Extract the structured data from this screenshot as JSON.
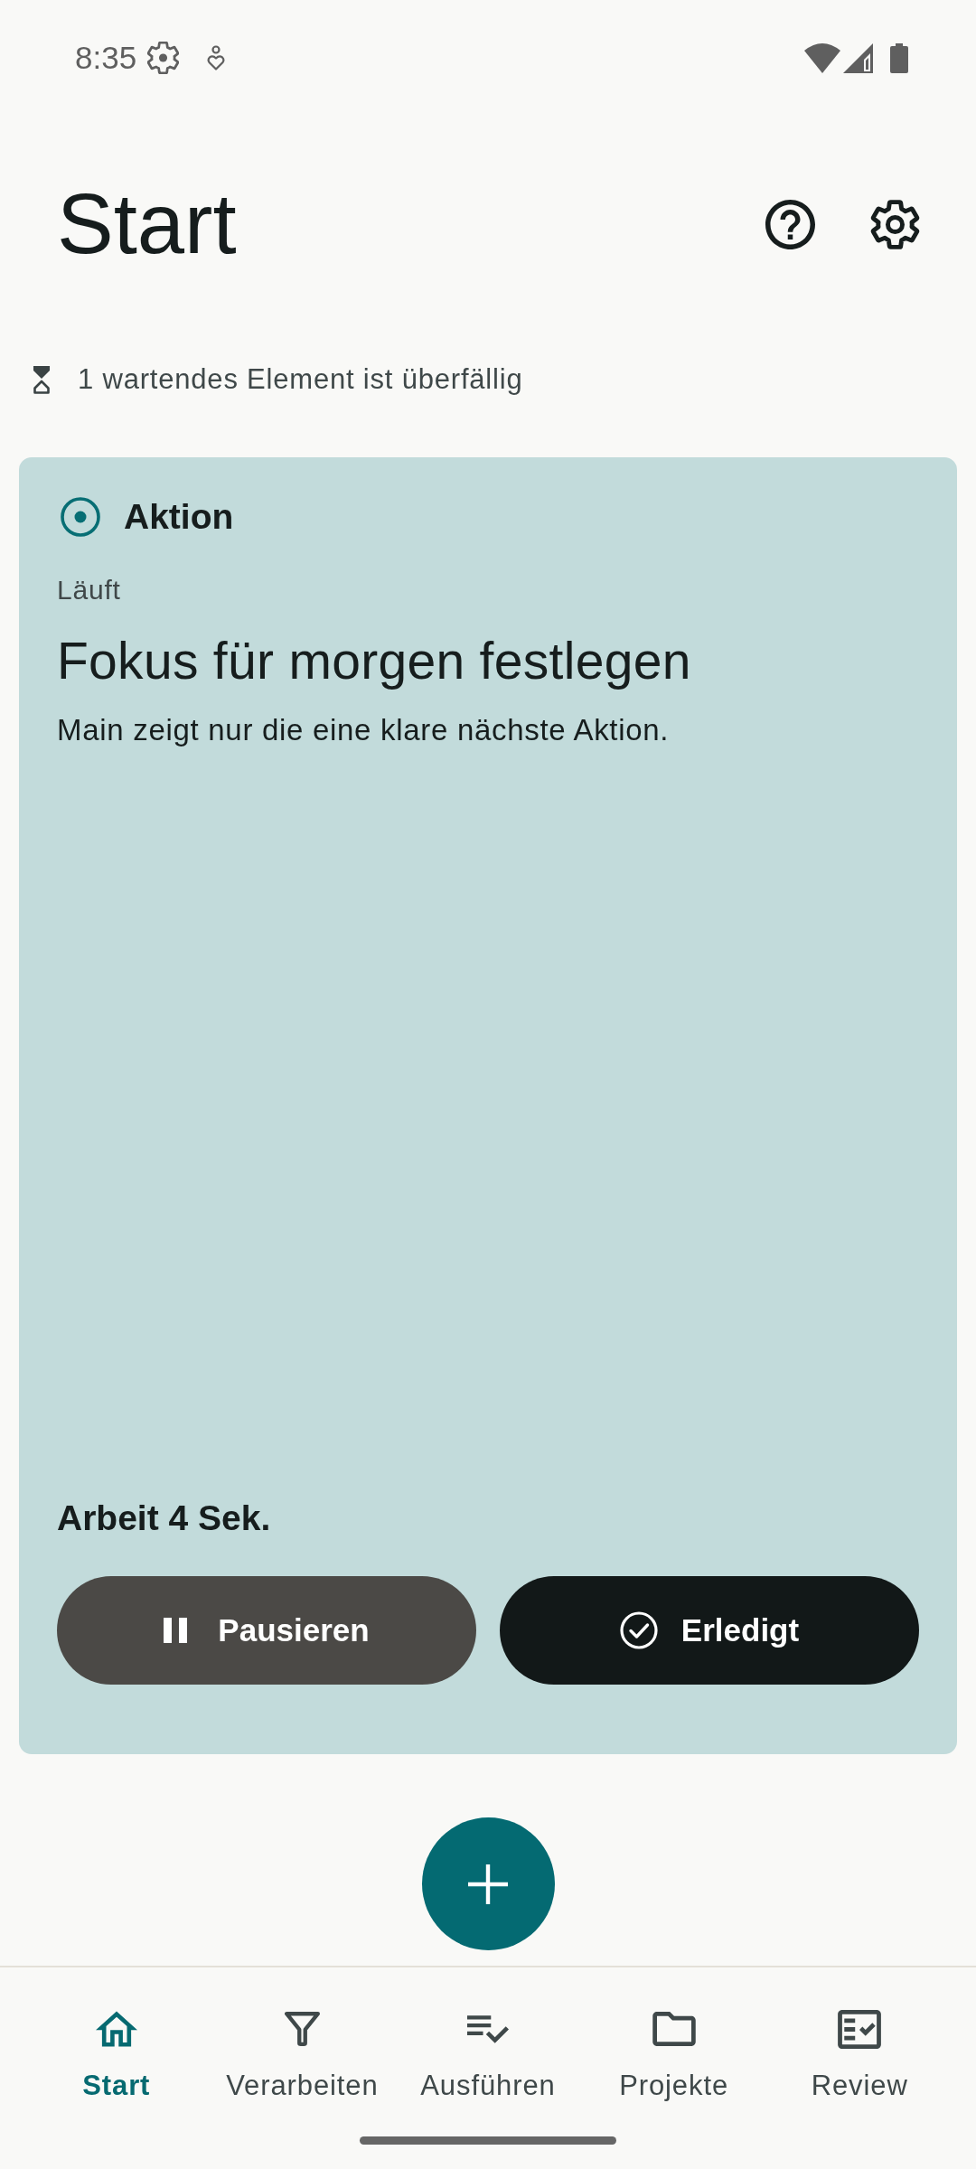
{
  "status_bar": {
    "time": "8:35"
  },
  "header": {
    "title": "Start"
  },
  "notice": {
    "text": "1 wartendes Element ist überfällig"
  },
  "card": {
    "label": "Aktion",
    "status": "Läuft",
    "title": "Fokus für morgen festlegen",
    "description": "Main zeigt nur die eine klare nächste Aktion.",
    "timer": "Arbeit 4 Sek.",
    "buttons": [
      {
        "label": "Pausieren",
        "kind": "pause"
      },
      {
        "label": "Erledigt",
        "kind": "done"
      }
    ]
  },
  "bottom_nav": [
    {
      "label": "Start",
      "selected": true
    },
    {
      "label": "Verarbeiten",
      "selected": false
    },
    {
      "label": "Ausführen",
      "selected": false
    },
    {
      "label": "Projekte",
      "selected": false
    },
    {
      "label": "Review",
      "selected": false
    }
  ]
}
